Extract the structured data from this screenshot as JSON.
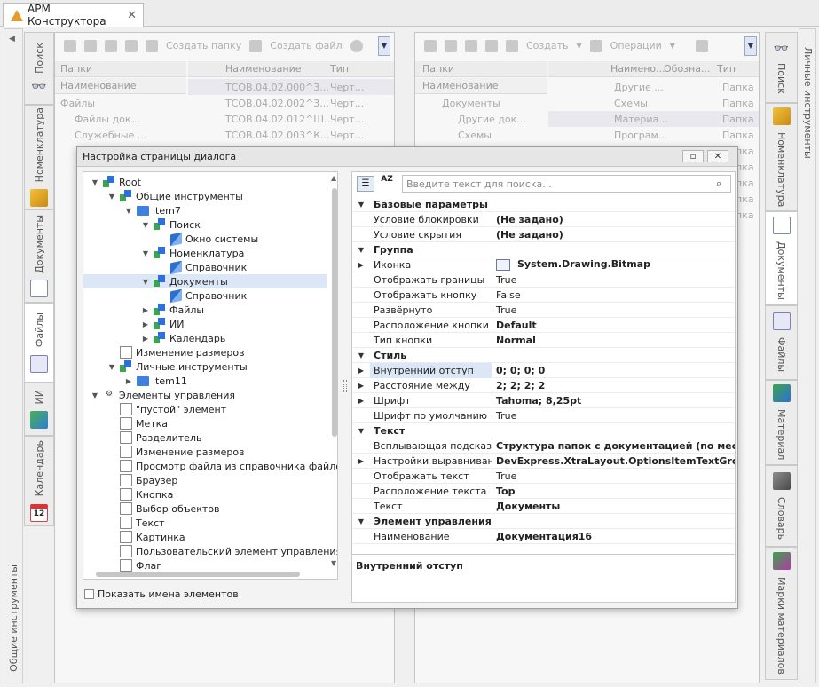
{
  "app": {
    "tab_title": "АРМ Конструктора",
    "close_label": "✕"
  },
  "left_sidebar": {
    "bottom_label": "Общие инструменты",
    "tabs": [
      {
        "label": "Поиск",
        "icon": "binoculars-icon"
      },
      {
        "label": "Номенклатура",
        "icon": "cube-icon"
      },
      {
        "label": "Документы",
        "icon": "document-icon"
      },
      {
        "label": "Файлы",
        "icon": "files-icon"
      },
      {
        "label": "ИИ",
        "icon": "refresh-icon"
      },
      {
        "label": "Календарь",
        "icon": "calendar-icon"
      }
    ],
    "calendar_day": "12"
  },
  "right_sidebar": {
    "top_label": "Личные инструменты",
    "tabs": [
      {
        "label": "Поиск"
      },
      {
        "label": "Номенклатура"
      },
      {
        "label": "Документы"
      },
      {
        "label": "Файлы"
      },
      {
        "label": "Материал"
      },
      {
        "label": "Словарь"
      },
      {
        "label": "Марки материалов"
      }
    ]
  },
  "left_panel": {
    "toolbar": {
      "create_folder": "Создать папку",
      "create_file": "Создать файл"
    },
    "folders_header": "Папки",
    "folders_col": "Наименование",
    "folders_rows": [
      "Файлы",
      "Файлы док...",
      "Служебные ..."
    ],
    "files_cols": [
      "Наименование",
      "Тип"
    ],
    "files_rows": [
      {
        "name": "ТСОВ.04.02.000^3...",
        "type": "Черт..."
      },
      {
        "name": "ТСОВ.04.02.002^3...",
        "type": "Черт..."
      },
      {
        "name": "ТСОВ.04.02.012^Ш...",
        "type": "Черт..."
      },
      {
        "name": "ТСОВ.04.02.003^К...",
        "type": "Черт..."
      }
    ]
  },
  "right_panel": {
    "toolbar": {
      "create": "Создать",
      "operations": "Операции"
    },
    "folders_header": "Папки",
    "folders_col": "Наименование",
    "folders_rows": [
      "Документы",
      "Другие док...",
      "Схемы"
    ],
    "cols": [
      "Наимено...",
      "Обозна...",
      "Тип"
    ],
    "rows": [
      {
        "name": "Другие ...",
        "type": "Папка"
      },
      {
        "name": "Схемы",
        "type": "Папка"
      },
      {
        "name": "Материа...",
        "type": "Папка"
      },
      {
        "name": "Програм...",
        "type": "Папка"
      },
      {
        "name": "",
        "type": "Папка"
      },
      {
        "name": "",
        "type": "Папка"
      },
      {
        "name": "",
        "type": "Папка"
      },
      {
        "name": "",
        "type": "Папка"
      },
      {
        "name": "",
        "type": "Папка"
      }
    ]
  },
  "dialog": {
    "title": "Настройка страницы диалога",
    "search_placeholder": "Введите текст для поиска...",
    "show_names_label": "Показать имена элементов",
    "description": "Внутренний отступ",
    "tree": [
      {
        "label": "Root",
        "level": 0,
        "arrow": "down",
        "icon": "node"
      },
      {
        "label": "Общие инструменты",
        "level": 1,
        "arrow": "down",
        "icon": "node"
      },
      {
        "label": "item7",
        "level": 2,
        "arrow": "down",
        "icon": "folder"
      },
      {
        "label": "Поиск",
        "level": 3,
        "arrow": "down",
        "icon": "node"
      },
      {
        "label": "Окно системы",
        "level": 4,
        "arrow": "",
        "icon": "book"
      },
      {
        "label": "Номенклатура",
        "level": 3,
        "arrow": "down",
        "icon": "node"
      },
      {
        "label": "Справочник",
        "level": 4,
        "arrow": "",
        "icon": "book"
      },
      {
        "label": "Документы",
        "level": 3,
        "arrow": "down",
        "icon": "node",
        "selected": true
      },
      {
        "label": "Справочник",
        "level": 4,
        "arrow": "",
        "icon": "book"
      },
      {
        "label": "Файлы",
        "level": 3,
        "arrow": "right",
        "icon": "node"
      },
      {
        "label": "ИИ",
        "level": 3,
        "arrow": "right",
        "icon": "node"
      },
      {
        "label": "Календарь",
        "level": 3,
        "arrow": "right",
        "icon": "node"
      },
      {
        "label": "Изменение размеров",
        "level": 1,
        "arrow": "",
        "icon": "ctl"
      },
      {
        "label": "Личные инструменты",
        "level": 1,
        "arrow": "down",
        "icon": "node"
      },
      {
        "label": "item11",
        "level": 2,
        "arrow": "right",
        "icon": "folder"
      },
      {
        "label": "Элементы управления",
        "level": 0,
        "arrow": "down",
        "icon": "gear"
      },
      {
        "label": "\"пустой\" элемент",
        "level": 1,
        "arrow": "",
        "icon": "ctl"
      },
      {
        "label": "Метка",
        "level": 1,
        "arrow": "",
        "icon": "ctl"
      },
      {
        "label": "Разделитель",
        "level": 1,
        "arrow": "",
        "icon": "ctl"
      },
      {
        "label": "Изменение размеров",
        "level": 1,
        "arrow": "",
        "icon": "ctl"
      },
      {
        "label": "Просмотр файла из справочника файлов",
        "level": 1,
        "arrow": "",
        "icon": "ctl"
      },
      {
        "label": "Браузер",
        "level": 1,
        "arrow": "",
        "icon": "ctl"
      },
      {
        "label": "Кнопка",
        "level": 1,
        "arrow": "",
        "icon": "ctl"
      },
      {
        "label": "Выбор объектов",
        "level": 1,
        "arrow": "",
        "icon": "ctl"
      },
      {
        "label": "Текст",
        "level": 1,
        "arrow": "",
        "icon": "ctl"
      },
      {
        "label": "Картинка",
        "level": 1,
        "arrow": "",
        "icon": "ctl"
      },
      {
        "label": "Пользовательский элемент управления",
        "level": 1,
        "arrow": "",
        "icon": "ctl"
      },
      {
        "label": "Флаг",
        "level": 1,
        "arrow": "",
        "icon": "ctl"
      }
    ],
    "props": [
      {
        "kind": "cat",
        "name": "Базовые параметры"
      },
      {
        "kind": "prop",
        "name": "Условие блокировки",
        "value": "(Не задано)",
        "bold": true
      },
      {
        "kind": "prop",
        "name": "Условие скрытия",
        "value": "(Не задано)",
        "bold": true
      },
      {
        "kind": "cat",
        "name": "Группа"
      },
      {
        "kind": "prop",
        "name": "Иконка",
        "value": "System.Drawing.Bitmap",
        "bold": true,
        "expand": true
      },
      {
        "kind": "prop",
        "name": "Отображать границы",
        "value": "True"
      },
      {
        "kind": "prop",
        "name": "Отображать кнопку",
        "value": "False"
      },
      {
        "kind": "prop",
        "name": "Развёрнуто",
        "value": "True"
      },
      {
        "kind": "prop",
        "name": "Расположение кнопки",
        "value": "Default",
        "bold": true
      },
      {
        "kind": "prop",
        "name": "Тип кнопки",
        "value": "Normal",
        "bold": true
      },
      {
        "kind": "cat",
        "name": "Стиль"
      },
      {
        "kind": "prop",
        "name": "Внутренний отступ",
        "value": "0; 0; 0; 0",
        "bold": true,
        "expand": true,
        "selected": true
      },
      {
        "kind": "prop",
        "name": "Расстояние между",
        "value": "2; 2; 2; 2",
        "bold": true,
        "expand": true
      },
      {
        "kind": "prop",
        "name": "Шрифт",
        "value": "Tahoma; 8,25pt",
        "bold": true,
        "expand": true
      },
      {
        "kind": "prop",
        "name": "Шрифт по умолчанию",
        "value": "True"
      },
      {
        "kind": "cat",
        "name": "Текст"
      },
      {
        "kind": "prop",
        "name": "Всплывающая подсказка",
        "value": "Структура папок с документацией (по месту",
        "bold": true
      },
      {
        "kind": "prop",
        "name": "Настройки выравнивания",
        "value": "DevExpress.XtraLayout.OptionsItemTextGroup",
        "bold": true,
        "expand": true
      },
      {
        "kind": "prop",
        "name": "Отображать текст",
        "value": "True"
      },
      {
        "kind": "prop",
        "name": "Расположение текста",
        "value": "Top",
        "bold": true
      },
      {
        "kind": "prop",
        "name": "Текст",
        "value": "Документы",
        "bold": true
      },
      {
        "kind": "cat",
        "name": "Элемент управления"
      },
      {
        "kind": "prop",
        "name": "Наименование",
        "value": "Документация16",
        "bold": true
      }
    ]
  }
}
